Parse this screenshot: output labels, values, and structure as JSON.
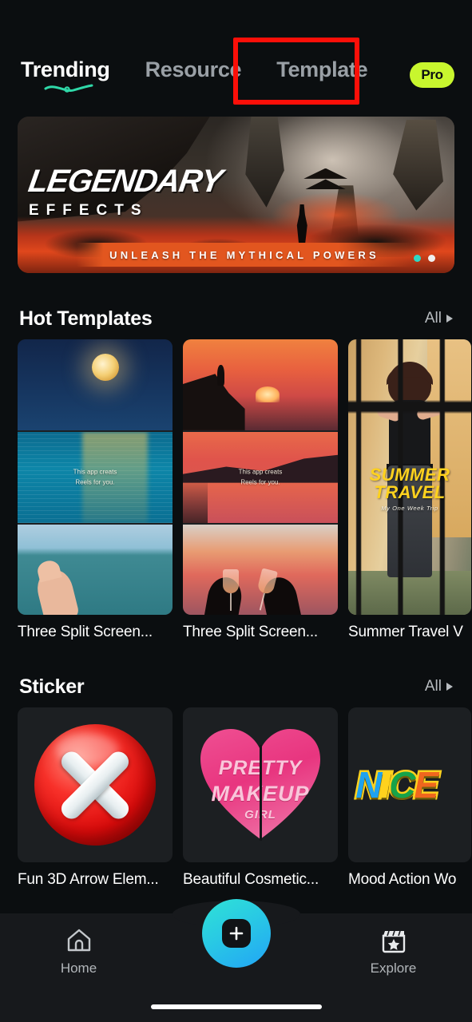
{
  "app": {
    "background_color": "#0b0e10",
    "card_color": "#1c1f22"
  },
  "header": {
    "tabs": [
      {
        "label": "Trending",
        "active": true
      },
      {
        "label": "Resource",
        "active": false
      },
      {
        "label": "Template",
        "active": false
      }
    ],
    "pro_badge": {
      "label": "Pro",
      "color": "#c8f62e"
    },
    "annotation": {
      "target": "Template",
      "color": "#fb0f08"
    }
  },
  "banner": {
    "title": "LEGENDARY",
    "subtitle": "EFFECTS",
    "ribbon": "UNLEASH  THE  MYTHICAL  POWERS",
    "dots": [
      {
        "state": "active",
        "color": "#2fd8c4"
      },
      {
        "state": "idle",
        "color": "#f0f0f0"
      }
    ]
  },
  "sections": [
    {
      "title": "Hot Templates",
      "all_label": "All",
      "cards": [
        {
          "title": "Three Split Screen...",
          "overlay_line1": "This app creats",
          "overlay_line2": "Reels for you."
        },
        {
          "title": "Three Split Screen...",
          "overlay_line1": "This app creats",
          "overlay_line2": "Reels for you."
        },
        {
          "title": "Summer Travel V",
          "art_line1": "SUMMER",
          "art_line2": "TRAVEL",
          "art_sub": "My One Week Trip"
        }
      ]
    },
    {
      "title": "Sticker",
      "all_label": "All",
      "cards": [
        {
          "title": "Fun 3D Arrow Elem..."
        },
        {
          "title": "Beautiful Cosmetic...",
          "art_line1": "PRETTY",
          "art_line2": "MAKEUP",
          "art_line3": "GIRL"
        },
        {
          "title": "Mood Action Wo",
          "letters": [
            "N",
            "I",
            "C",
            "E"
          ]
        }
      ]
    }
  ],
  "bottom_nav": {
    "items": [
      {
        "label": "Home",
        "icon": "home-icon"
      },
      {
        "label": "Explore",
        "icon": "clapperboard-star-icon"
      }
    ],
    "create_button": {
      "icon": "plus-icon"
    }
  }
}
